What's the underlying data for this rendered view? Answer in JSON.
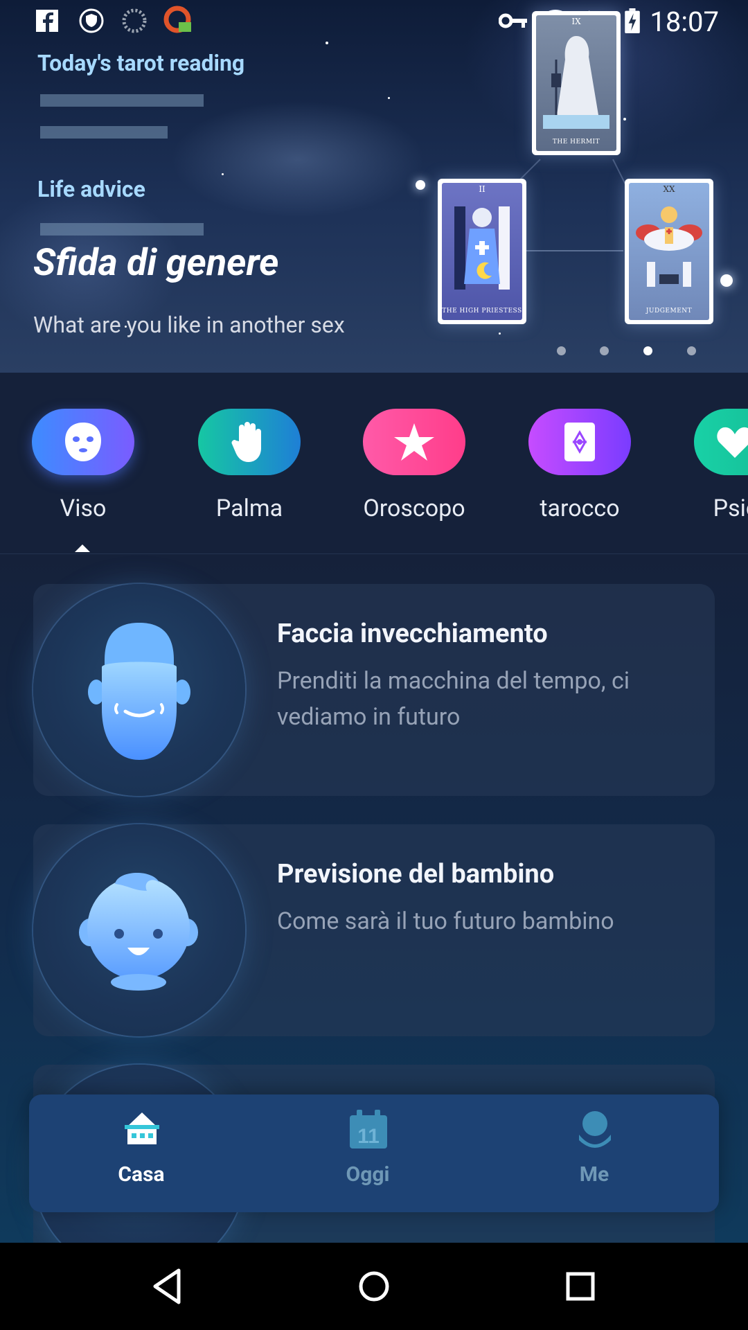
{
  "status_bar": {
    "time": "18:07",
    "left_icons": [
      "facebook-icon",
      "shield-icon",
      "loading-icon",
      "vpn-app-icon"
    ],
    "right_icons": [
      "key-icon",
      "wifi-off-icon",
      "no-sim-icon",
      "battery-charging-icon"
    ]
  },
  "hero": {
    "tarot_label": "Today's tarot reading",
    "advice_label": "Life advice",
    "title": "Sfida di genere",
    "subtitle": "What are you like in another sex",
    "cards": [
      {
        "numeral": "IX",
        "name": "THE HERMIT"
      },
      {
        "numeral": "II",
        "name": "THE HIGH PRIESTESS"
      },
      {
        "numeral": "XX",
        "name": "JUDGEMENT"
      }
    ],
    "carousel": {
      "count": 4,
      "active_index": 2
    }
  },
  "categories": [
    {
      "label": "Viso",
      "icon": "face-mask-icon",
      "colors": [
        "#3d8cff",
        "#7a5cff"
      ],
      "selected": true
    },
    {
      "label": "Palma",
      "icon": "palm-hand-icon",
      "colors": [
        "#16c7a3",
        "#1e7fd6"
      ],
      "selected": false
    },
    {
      "label": "Oroscopo",
      "icon": "star-icon",
      "colors": [
        "#ff5aa8",
        "#ff3d8a"
      ],
      "selected": false
    },
    {
      "label": "tarocco",
      "icon": "tarot-card-icon",
      "colors": [
        "#c64cff",
        "#7a3cff"
      ],
      "selected": false
    },
    {
      "label": "Psicol",
      "icon": "heart-icon",
      "colors": [
        "#18d1a6",
        "#16b894"
      ],
      "selected": false
    }
  ],
  "features": [
    {
      "title": "Faccia invecchiamento",
      "description": "Prenditi la macchina del tempo, ci vediamo in futuro",
      "icon": "aging-face-icon"
    },
    {
      "title": "Previsione del bambino",
      "description": "Come sarà il tuo futuro bambino",
      "icon": "baby-face-icon"
    }
  ],
  "bottom_nav": [
    {
      "label": "Casa",
      "icon": "home-icon",
      "active": true
    },
    {
      "label": "Oggi",
      "icon": "calendar-icon",
      "active": false,
      "calendar_day": "11"
    },
    {
      "label": "Me",
      "icon": "profile-icon",
      "active": false
    }
  ],
  "colors": {
    "nav_active": "#ffffff",
    "nav_inactive": "#6f98b6",
    "hero_label": "#a7d9ff"
  }
}
